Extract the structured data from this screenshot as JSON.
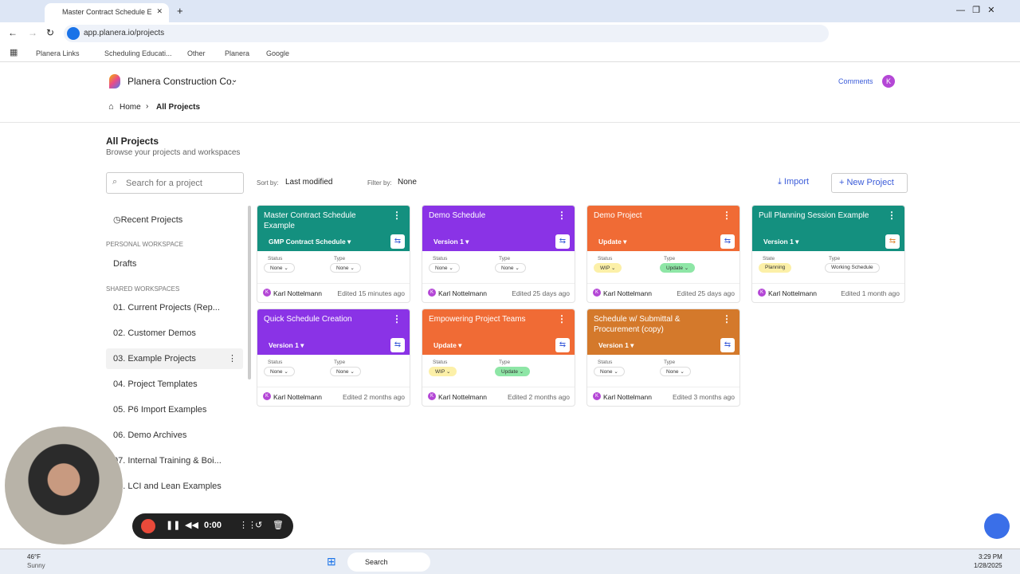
{
  "browser": {
    "tab_title": "Master Contract Schedule E",
    "url": "app.planera.io/projects",
    "bookmarks": [
      "Planera Links",
      "Scheduling Educati...",
      "Other",
      "Planera",
      "Google"
    ]
  },
  "app": {
    "org": "Planera Construction Co.",
    "comments": "Comments",
    "avatar": "K",
    "breadcrumb": [
      "Home",
      "All Projects"
    ]
  },
  "page": {
    "title": "All Projects",
    "subtitle": "Browse your projects and workspaces",
    "search_placeholder": "Search for a project",
    "sort_label": "Sort by:",
    "sort_value": "Last modified",
    "filter_label": "Filter by:",
    "filter_value": "None",
    "import": "Import",
    "new_project": "New Project"
  },
  "sidebar": {
    "recent": "Recent Projects",
    "personal_header": "PERSONAL WORKSPACE",
    "drafts": "Drafts",
    "shared_header": "SHARED WORKSPACES",
    "items": [
      "01. Current Projects (Rep...",
      "02. Customer Demos",
      "03. Example Projects",
      "04. Project Templates",
      "05. P6 Import Examples",
      "06. Demo Archives",
      "07. Internal Training & Boi...",
      "08. LCI and Lean Examples"
    ]
  },
  "cards": [
    {
      "title": "Master Contract Schedule Example",
      "version": "GMP Contract Schedule",
      "color": "#14907f",
      "l1": "Status",
      "l2": "Type",
      "v1": "None",
      "v2": "None",
      "owner": "Karl Nottelmann",
      "edited": "Edited 15 minutes ago"
    },
    {
      "title": "Demo Schedule",
      "version": "Version 1",
      "color": "#8a33e6",
      "l1": "Status",
      "l2": "Type",
      "v1": "None",
      "v2": "None",
      "owner": "Karl Nottelmann",
      "edited": "Edited 25 days ago"
    },
    {
      "title": "Demo Project",
      "version": "Update",
      "color": "#f06b35",
      "l1": "Status",
      "l2": "Type",
      "v1": "WIP",
      "v2": "Update",
      "owner": "Karl Nottelmann",
      "edited": "Edited 25 days ago"
    },
    {
      "title": "Pull Planning Session Example",
      "version": "Version 1",
      "color": "#14907f",
      "l1": "State",
      "l2": "Type",
      "v1": "Planning",
      "v2": "Working Schedule",
      "owner": "Karl Nottelmann",
      "edited": "Edited 1 month ago"
    },
    {
      "title": "Quick Schedule Creation",
      "version": "Version 1",
      "color": "#8a33e6",
      "l1": "Status",
      "l2": "Type",
      "v1": "None",
      "v2": "None",
      "owner": "Karl Nottelmann",
      "edited": "Edited 2 months ago"
    },
    {
      "title": "Empowering Project Teams",
      "version": "Update",
      "color": "#f06b35",
      "l1": "Status",
      "l2": "Type",
      "v1": "WIP",
      "v2": "Update",
      "owner": "Karl Nottelmann",
      "edited": "Edited 2 months ago"
    },
    {
      "title": "Schedule w/ Submittal & Procurement (copy)",
      "version": "Version 1",
      "color": "#d4792b",
      "l1": "Status",
      "l2": "Type",
      "v1": "None",
      "v2": "None",
      "owner": "Karl Nottelmann",
      "edited": "Edited 3 months ago"
    }
  ],
  "recorder": {
    "time": "0:00"
  },
  "taskbar": {
    "temp": "46°F",
    "weather": "Sunny",
    "search": "Search",
    "time": "3:29 PM",
    "date": "1/28/2025"
  }
}
